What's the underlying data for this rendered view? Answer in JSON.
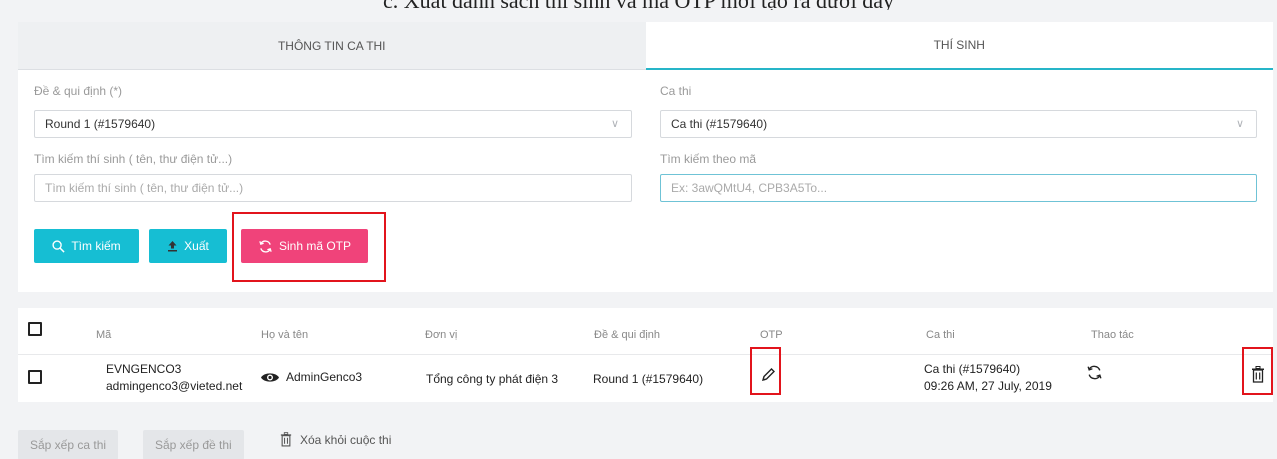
{
  "caption": "c. Xuất danh sách thí sinh và mã OTP mới tạo ra dưới đây",
  "tabs": [
    {
      "label": "THÔNG TIN CA THI",
      "active": false
    },
    {
      "label": "THÍ SINH",
      "active": true
    }
  ],
  "form": {
    "exam_rule_label": "Đề & qui định (*)",
    "exam_rule_value": "Round 1 (#1579640)",
    "session_label": "Ca thi",
    "session_value": "Ca thi (#1579640)",
    "search_label": "Tìm kiếm thí sinh ( tên, thư điện tử...)",
    "search_placeholder": "Tìm kiếm thí sinh ( tên, thư điện tử...)",
    "code_label": "Tìm kiếm theo mã",
    "code_placeholder": "Ex: 3awQMtU4, CPB3A5To..."
  },
  "actions": {
    "search": "Tìm kiếm",
    "export": "Xuất",
    "generate_otp": "Sinh mã OTP"
  },
  "colors": {
    "accent": "#16bed3",
    "otp_button": "#f0437a",
    "highlight": "#e2141c"
  },
  "table": {
    "headers": [
      "Mã",
      "Họ và tên",
      "Đơn vị",
      "Đề & qui định",
      "OTP",
      "Ca thi",
      "Thao tác"
    ],
    "rows": [
      {
        "code": "EVNGENCO3",
        "email": "admingenco3@vieted.net",
        "name": "AdminGenco3",
        "unit": "Tổng công ty phát điện 3",
        "rule": "Round 1 (#1579640)",
        "otp_icon": "pencil-icon",
        "session": "Ca thi (#1579640)",
        "session_time": "09:26 AM, 27 July, 2019",
        "action_icon": "refresh-icon"
      }
    ]
  },
  "footer": {
    "sort_session": "Sắp xếp ca thi",
    "sort_exam": "Sắp xếp đề thi",
    "remove": "Xóa khỏi cuộc thi"
  }
}
